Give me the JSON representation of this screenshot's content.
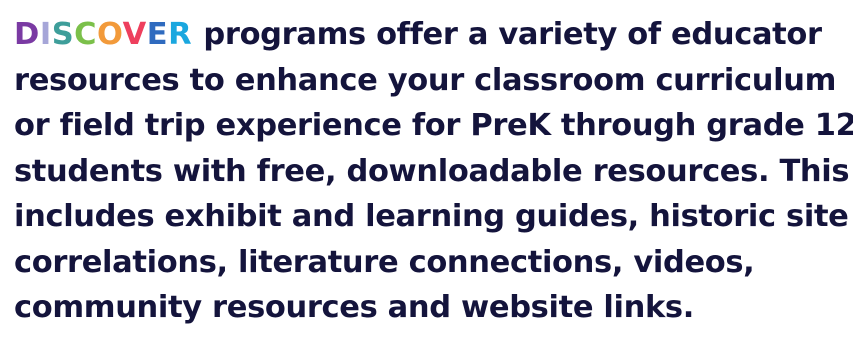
{
  "brand": {
    "letters": [
      {
        "char": "D",
        "color": "#7a3aa3"
      },
      {
        "char": "I",
        "color": "#a6a6d8"
      },
      {
        "char": "S",
        "color": "#3e9e9a"
      },
      {
        "char": "C",
        "color": "#7bc04a"
      },
      {
        "char": "O",
        "color": "#f29a3a"
      },
      {
        "char": "V",
        "color": "#ee3f5d"
      },
      {
        "char": "E",
        "color": "#2f6bbf"
      },
      {
        "char": "R",
        "color": "#1aa7df"
      }
    ]
  },
  "intro": {
    "lines": [
      "programs offer a variety of educator",
      "resources to enhance your classroom curriculum",
      "or field trip experience for PreK through grade 12",
      "students with free, downloadable resources. This",
      "includes exhibit and learning guides, historic site",
      "correlations, literature connections, videos,",
      "community resources and website links."
    ]
  },
  "colors": {
    "text": "#14143c",
    "background": "#ffffff"
  }
}
